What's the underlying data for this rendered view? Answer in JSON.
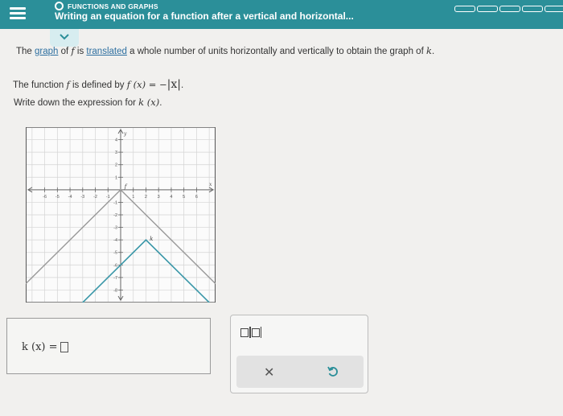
{
  "header": {
    "topic": "FUNCTIONS AND GRAPHS",
    "title": "Writing an equation for a function after a vertical and horizontal..."
  },
  "problem": {
    "s1_a": "The ",
    "s1_graph": "graph",
    "s1_b": " of ",
    "s1_f": "f",
    "s1_c": " is ",
    "s1_translated": "translated",
    "s1_d": " a whole number of units horizontally and vertically to obtain the graph of ",
    "s1_k": "k",
    "s1_e": ".",
    "s2_a": "The function ",
    "s2_f": "f",
    "s2_b": " is defined by ",
    "s2_eq": "f (x) = −",
    "s2_abs": "|x|",
    "s2_c": ".",
    "s3_a": "Write down the expression for ",
    "s3_k": "k (x)",
    "s3_b": "."
  },
  "graph": {
    "x_ticks": [
      "-6",
      "-5",
      "-4",
      "-3",
      "-2",
      "-1",
      "1",
      "2",
      "3",
      "4",
      "5",
      "6"
    ],
    "y_ticks_pos": [
      "4",
      "3",
      "2",
      "1"
    ],
    "y_ticks_neg": [
      "-1",
      "-2",
      "-3",
      "-4",
      "-5",
      "-6",
      "-7",
      "-8"
    ],
    "x_axis_label": "x",
    "y_axis_label": "y",
    "f_label": "f",
    "k_label": "k",
    "f_color": "#999999",
    "k_color": "#3a97a8"
  },
  "answer": {
    "label": "k (x) ="
  },
  "tools": {
    "clear": "✕",
    "undo_icon": "undo-icon"
  }
}
